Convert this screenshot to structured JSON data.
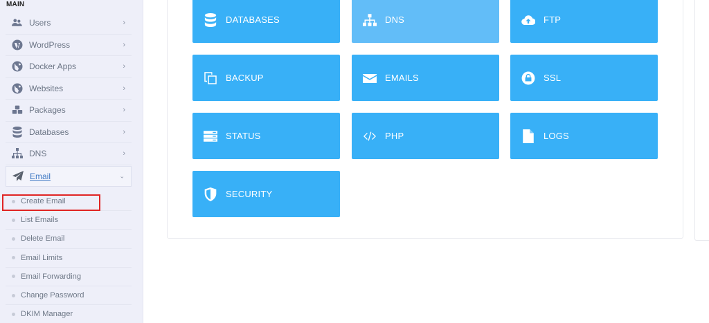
{
  "sidebar": {
    "section_label": "MAIN",
    "items": [
      {
        "label": "Users",
        "icon": "users-icon"
      },
      {
        "label": "WordPress",
        "icon": "wordpress-icon"
      },
      {
        "label": "Docker Apps",
        "icon": "globe-icon"
      },
      {
        "label": "Websites",
        "icon": "globe-icon"
      },
      {
        "label": "Packages",
        "icon": "cubes-icon"
      },
      {
        "label": "Databases",
        "icon": "database-icon"
      },
      {
        "label": "DNS",
        "icon": "sitemap-icon"
      },
      {
        "label": "Email",
        "icon": "paper-plane-icon"
      }
    ],
    "sub_items": [
      {
        "label": "Create Email"
      },
      {
        "label": "List Emails"
      },
      {
        "label": "Delete Email"
      },
      {
        "label": "Email Limits"
      },
      {
        "label": "Email Forwarding"
      },
      {
        "label": "Change Password"
      },
      {
        "label": "DKIM Manager"
      }
    ],
    "highlighted": "Create Email"
  },
  "tiles": [
    {
      "label": "DATABASES",
      "icon": "database-icon"
    },
    {
      "label": "DNS",
      "icon": "sitemap-icon"
    },
    {
      "label": "FTP",
      "icon": "cloud-upload-icon"
    },
    {
      "label": "BACKUP",
      "icon": "copy-icon"
    },
    {
      "label": "EMAILS",
      "icon": "envelope-icon"
    },
    {
      "label": "SSL",
      "icon": "lock-icon"
    },
    {
      "label": "STATUS",
      "icon": "server-icon"
    },
    {
      "label": "PHP",
      "icon": "code-icon"
    },
    {
      "label": "LOGS",
      "icon": "file-icon"
    },
    {
      "label": "SECURITY",
      "icon": "shield-icon"
    }
  ],
  "colors": {
    "tile": "#38b0f7",
    "tile_active": "#62bdf8",
    "sidebar_bg": "#eeeff9",
    "highlight": "#e02424"
  }
}
